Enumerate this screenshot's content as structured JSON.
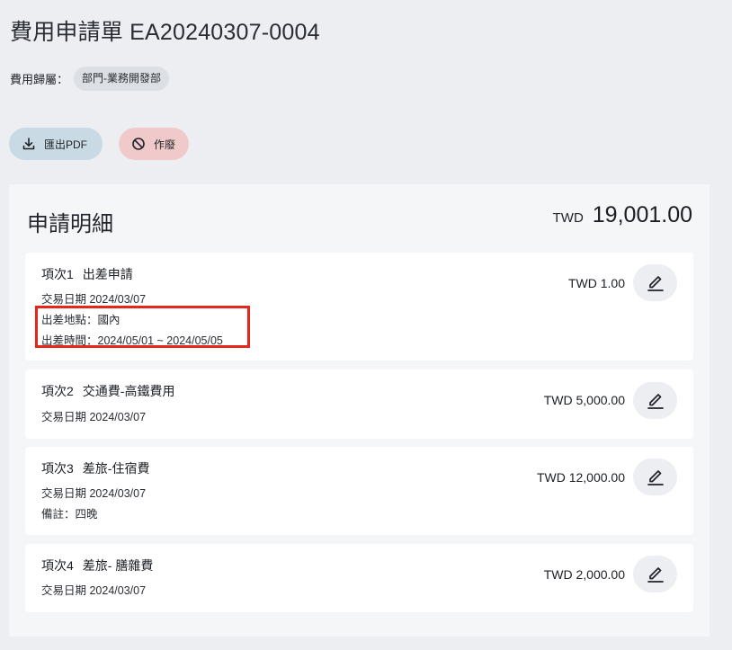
{
  "header": {
    "title": "費用申請單 EA20240307-0004"
  },
  "category": {
    "label": "費用歸屬：",
    "value": "部門-業務開發部"
  },
  "actions": {
    "export_label": "匯出PDF",
    "void_label": "作廢"
  },
  "details": {
    "title": "申請明細",
    "total_currency": "TWD",
    "total_amount": "19,001.00",
    "items": [
      {
        "no": "項次1",
        "name": "出差申請",
        "date_line": "交易日期 2024/03/07",
        "extra_lines": [
          "出差地點：國內",
          "出差時間：2024/05/01 ~ 2024/05/05"
        ],
        "amount": "TWD 1.00"
      },
      {
        "no": "項次2",
        "name": "交通費-高鐵費用",
        "date_line": "交易日期 2024/03/07",
        "extra_lines": [],
        "amount": "TWD 5,000.00"
      },
      {
        "no": "項次3",
        "name": "差旅-住宿費",
        "date_line": "交易日期 2024/03/07",
        "extra_lines": [
          "備註：四晚"
        ],
        "amount": "TWD 12,000.00"
      },
      {
        "no": "項次4",
        "name": "差旅- 膳雜費",
        "date_line": "交易日期 2024/03/07",
        "extra_lines": [],
        "amount": "TWD 2,000.00"
      }
    ]
  },
  "icons": {
    "export": "download-icon",
    "void": "ban-icon",
    "edit": "pencil-icon"
  },
  "colors": {
    "background": "#eceef2",
    "export_button": "#c9dae4",
    "void_button": "#f0caca",
    "highlight": "#e5261a"
  }
}
